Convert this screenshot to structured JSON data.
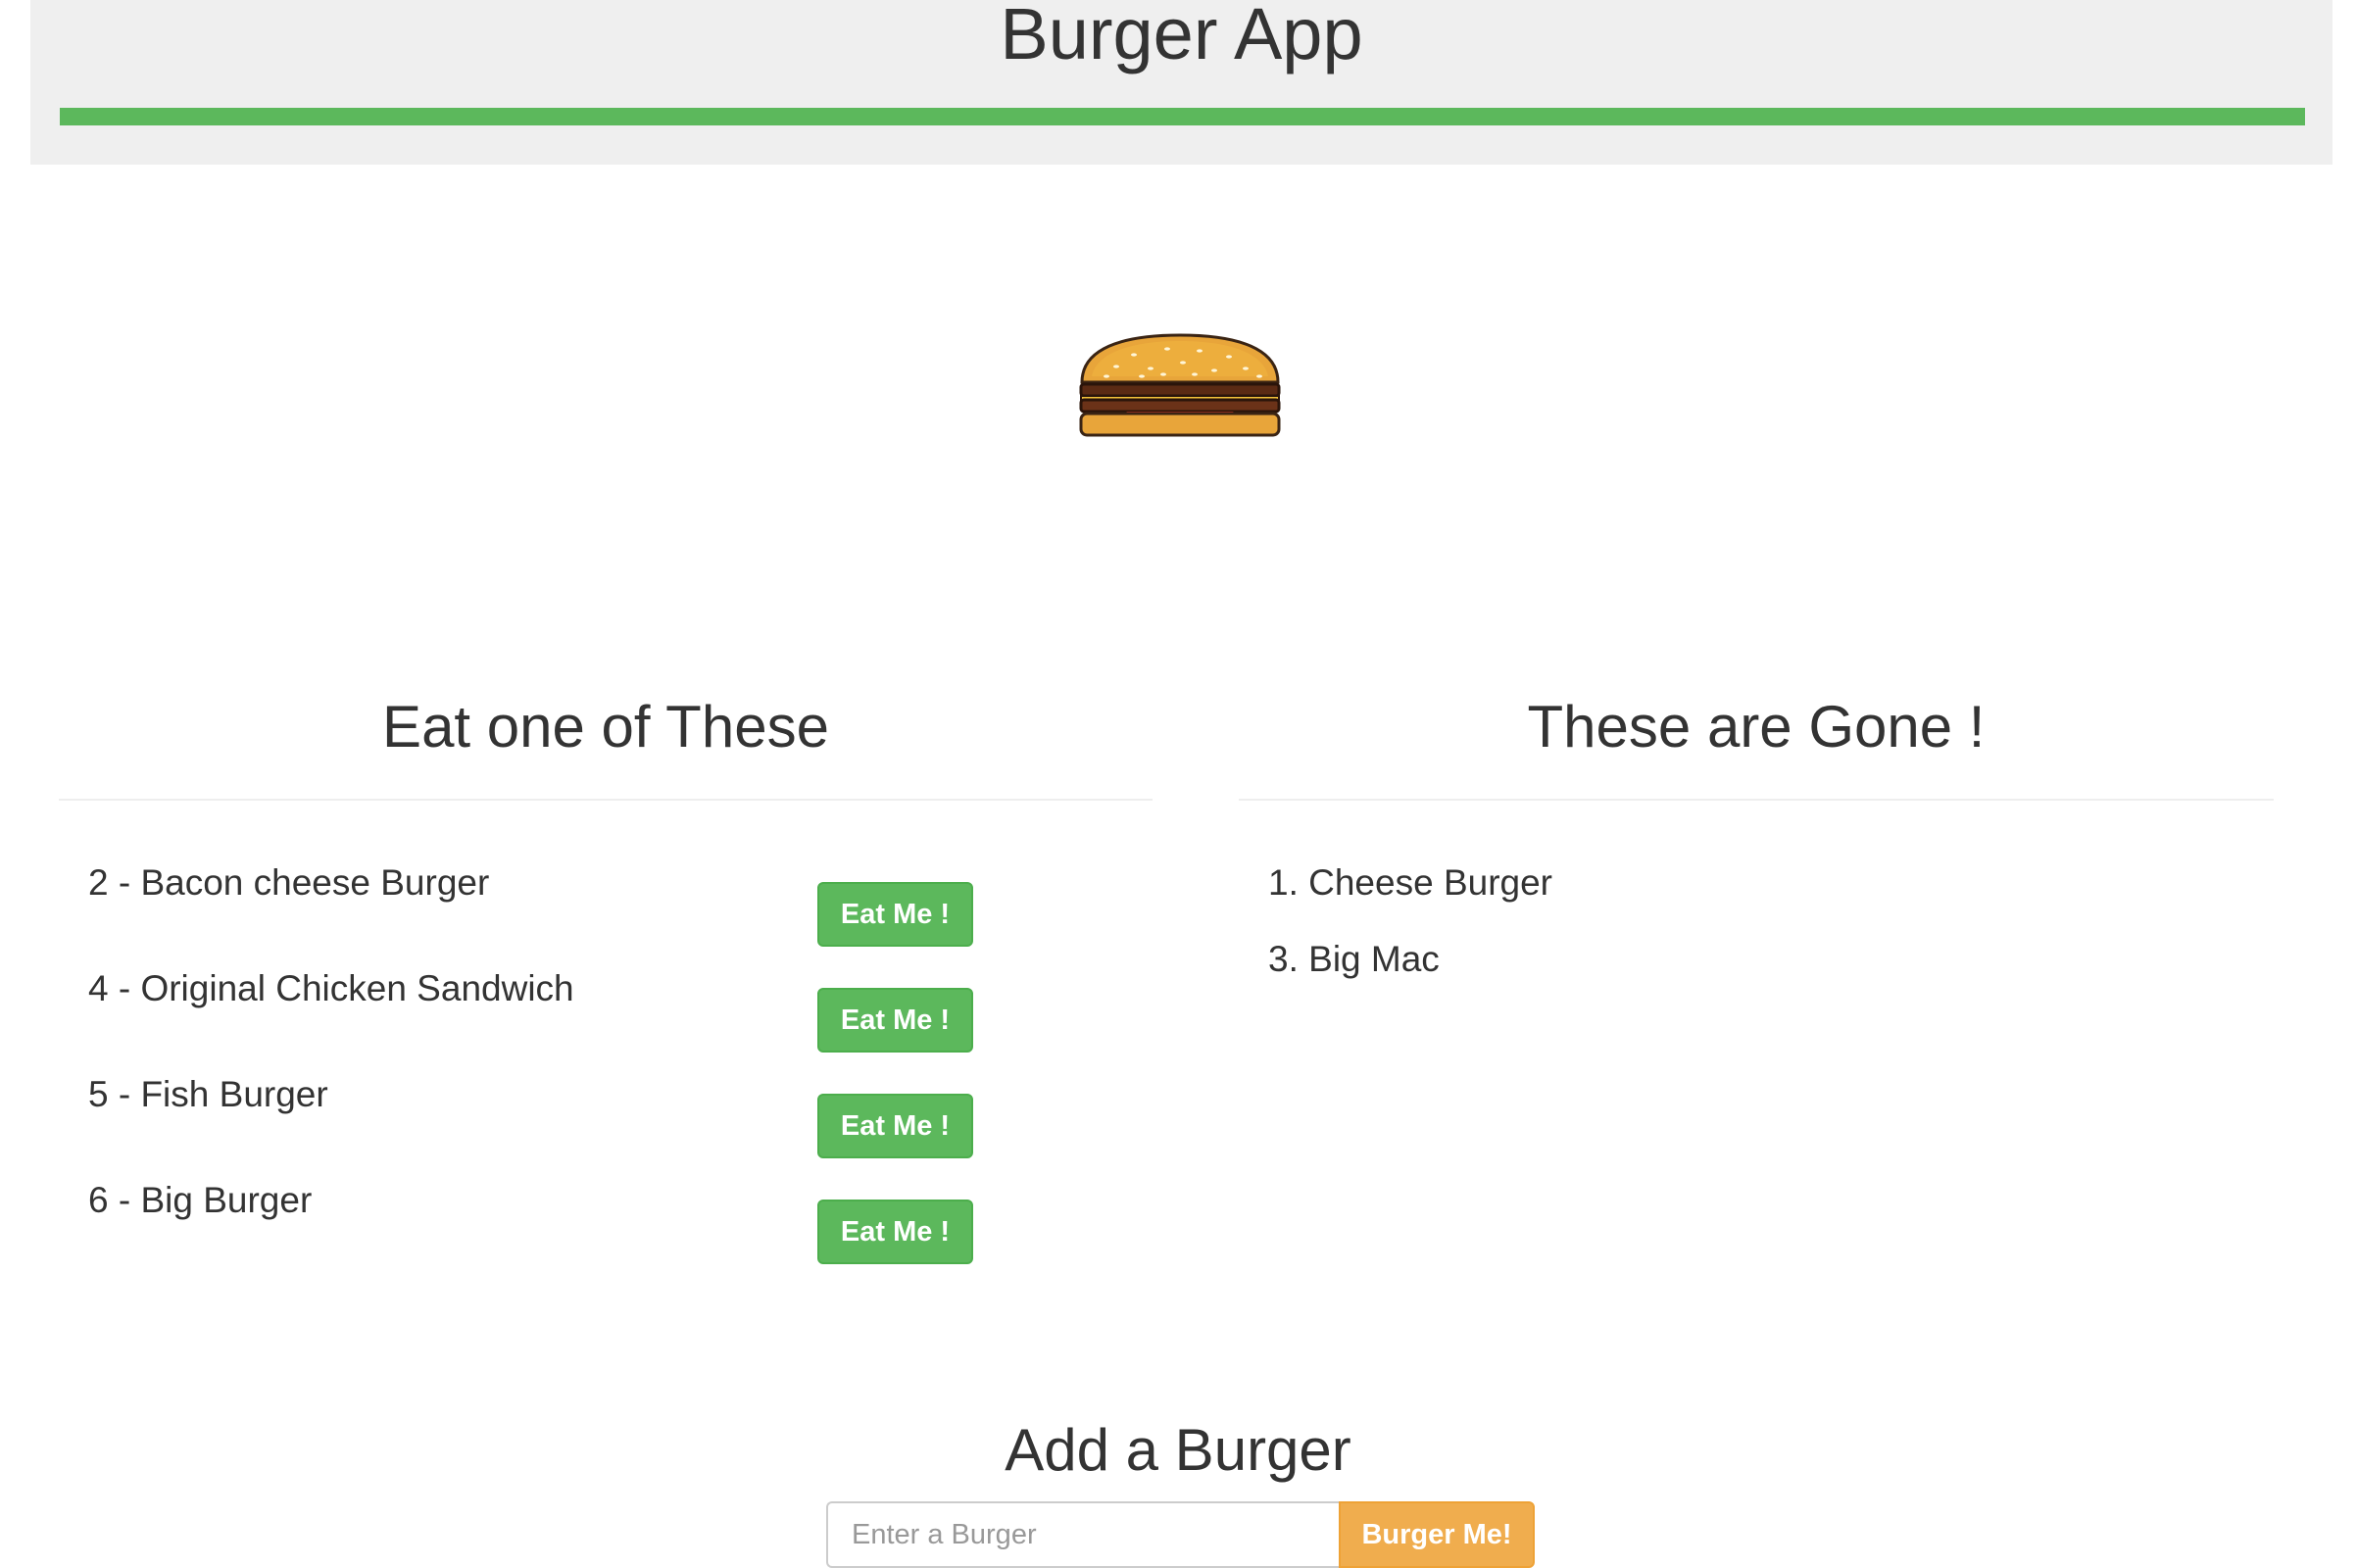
{
  "header": {
    "title": "Burger App",
    "bar_color": "#5cb85c"
  },
  "hero": {
    "icon": "burger-icon"
  },
  "uneaten": {
    "heading": "Eat one of These",
    "items": [
      {
        "label": "2 - Bacon cheese Burger",
        "button": "Eat Me !"
      },
      {
        "label": "4 - Original Chicken Sandwich",
        "button": "Eat Me !"
      },
      {
        "label": "5 - Fish Burger",
        "button": "Eat Me !"
      },
      {
        "label": "6 - Big Burger",
        "button": "Eat Me !"
      }
    ]
  },
  "devoured": {
    "heading": "These are Gone !",
    "items": [
      {
        "label": "1. Cheese Burger"
      },
      {
        "label": "3. Big Mac"
      }
    ]
  },
  "add_form": {
    "heading": "Add a Burger",
    "placeholder": "Enter a Burger",
    "value": "",
    "button": "Burger Me!"
  },
  "colors": {
    "success": "#5cb85c",
    "warning": "#f0ad4e",
    "header_bg": "#efefef"
  }
}
